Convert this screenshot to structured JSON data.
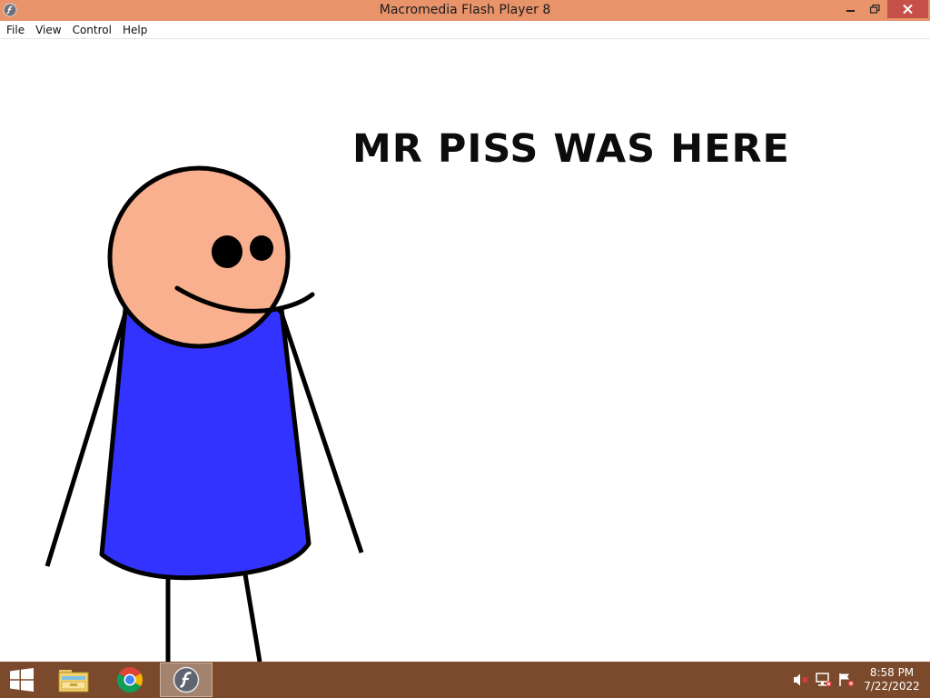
{
  "window": {
    "title": "Macromedia Flash Player 8",
    "accent_color": "#e8936a",
    "close_color": "#c7504a"
  },
  "menu": {
    "items": [
      {
        "label": "File"
      },
      {
        "label": "View"
      },
      {
        "label": "Control"
      },
      {
        "label": "Help"
      }
    ]
  },
  "stage": {
    "headline": "MR PISS WAS HERE",
    "figure": {
      "skin_color": "#f8b08e",
      "shirt_color": "#3333ff",
      "outline_color": "#000000"
    }
  },
  "taskbar": {
    "background": "#7b4a2c",
    "pinned": [
      {
        "icon": "windows-start-icon"
      },
      {
        "icon": "file-explorer-icon"
      },
      {
        "icon": "chrome-icon"
      },
      {
        "icon": "flash-player-icon"
      }
    ],
    "tray_icons": [
      "volume-muted-icon",
      "network-icon",
      "action-center-flag-icon"
    ],
    "clock": {
      "time": "8:58 PM",
      "date": "7/22/2022"
    }
  }
}
